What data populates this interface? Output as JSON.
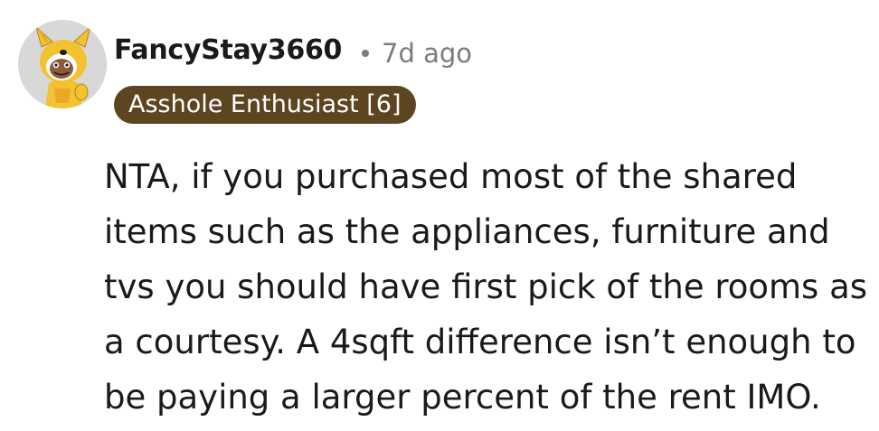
{
  "comment": {
    "author": "FancyStay3660",
    "timestamp": "7d ago",
    "flair": "Asshole Enthusiast [6]",
    "body": "NTA, if you purchased most of the shared items such as the appliances, furniture and tvs you should have first pick of the rooms as a courtesy. A 4sqft difference isn’t enough to be paying a larger percent of the rent IMO."
  },
  "icons": {
    "avatar": "snoo-avatar-dog-costume",
    "separator": "dot-separator"
  },
  "colors": {
    "flair_background": "#5c4520",
    "flair_text": "#ffffff",
    "meta_text": "#7c7c7c",
    "body_text": "#1a1a1b"
  }
}
